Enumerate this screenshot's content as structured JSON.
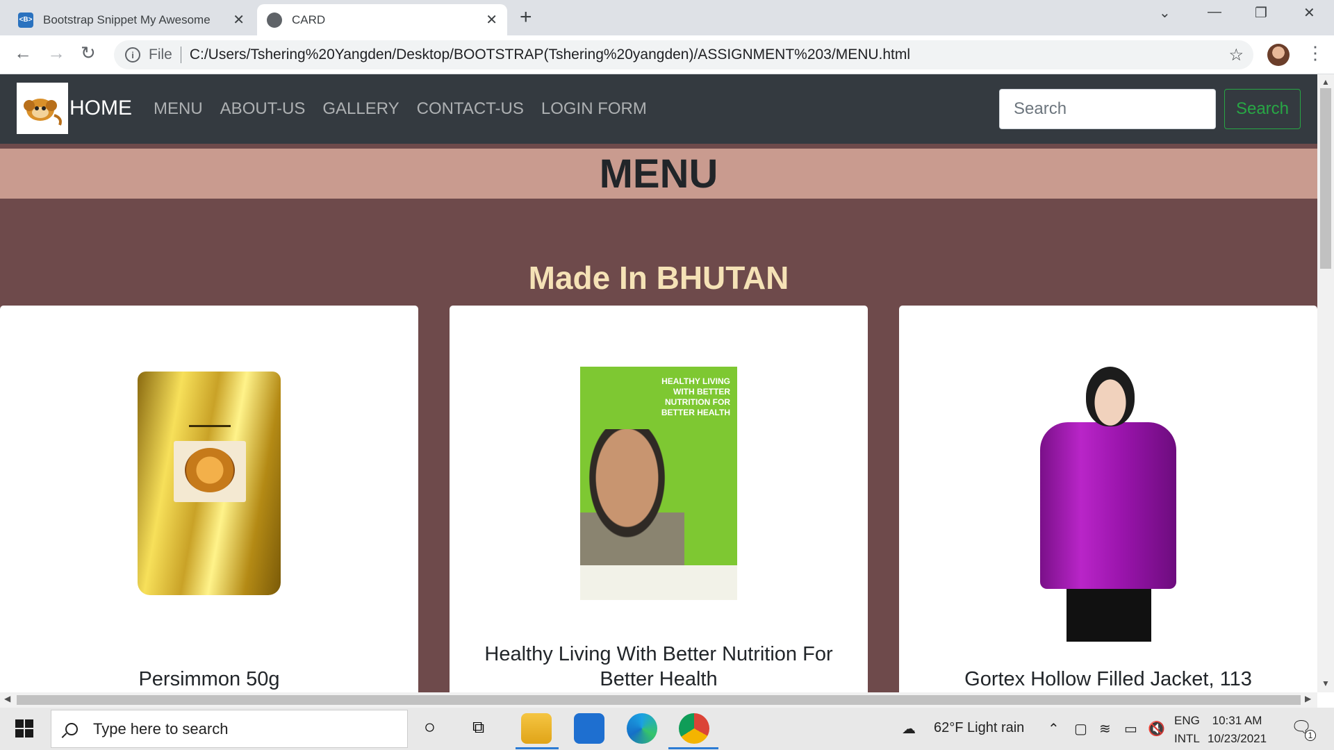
{
  "browser": {
    "tabs": [
      {
        "title": "Bootstrap Snippet My Awesome",
        "favicon": "bootstrap-icon",
        "active": false
      },
      {
        "title": "CARD",
        "favicon": "globe-icon",
        "active": true
      }
    ],
    "new_tab_icon": "+",
    "address": {
      "scheme_label": "File",
      "url": "C:/Users/Tshering%20Yangden/Desktop/BOOTSTRAP(Tshering%20yangden)/ASSIGNMENT%203/MENU.html"
    }
  },
  "navbar": {
    "brand": "HOME",
    "links": [
      "MENU",
      "ABOUT-US",
      "GALLERY",
      "CONTACT-US",
      "LOGIN FORM"
    ],
    "search_placeholder": "Search",
    "search_button": "Search",
    "colors": {
      "bg": "#343a40",
      "accent": "#28a745"
    }
  },
  "page": {
    "banner_title": "MENU",
    "subtitle": "Made In BHUTAN",
    "colors": {
      "bg": "#6e4a4b",
      "banner": "#c99b8f",
      "subtitle": "#f5e2b6"
    }
  },
  "cards": [
    {
      "title": "Persimmon 50g",
      "image": "persimmon-pouch"
    },
    {
      "title": "Healthy Living With Better Nutrition For Better Health",
      "image": "nutrition-book",
      "cover_text": "HEALTHY LIVING WITH BETTER NUTRITION FOR BETTER HEALTH"
    },
    {
      "title": "Gortex Hollow Filled Jacket, 113",
      "image": "purple-jacket"
    }
  ],
  "taskbar": {
    "search_placeholder": "Type here to search",
    "weather": "62°F  Light rain",
    "language": {
      "line1": "ENG",
      "line2": "INTL"
    },
    "time": "10:31 AM",
    "date": "10/23/2021",
    "notification_count": "1"
  }
}
